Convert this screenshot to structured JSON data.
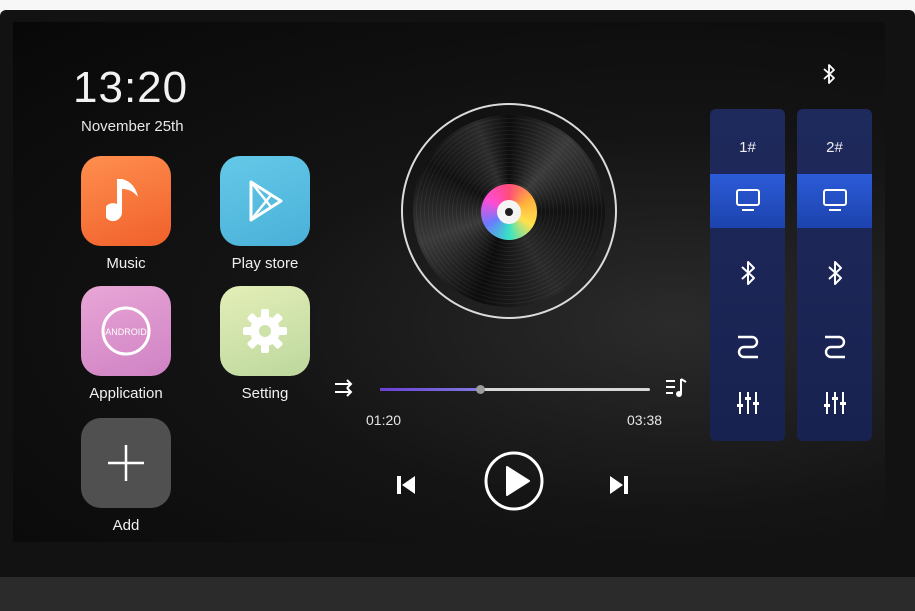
{
  "clock": {
    "time": "13:20",
    "date": "November 25th"
  },
  "apps": [
    {
      "label": "Music",
      "icon": "music-note-icon"
    },
    {
      "label": "Play store",
      "icon": "play-store-icon"
    },
    {
      "label": "Application",
      "icon": "android-icon",
      "icon_text": "ANDROID"
    },
    {
      "label": "Setting",
      "icon": "gear-icon"
    },
    {
      "label": "Add",
      "icon": "plus-icon"
    }
  ],
  "player": {
    "elapsed": "01:20",
    "duration": "03:38",
    "progress": 0.37,
    "controls": [
      "shuffle-icon",
      "previous-icon",
      "play-icon",
      "next-icon",
      "playlist-icon"
    ]
  },
  "status_bar": {
    "bluetooth_icon": "bluetooth-icon"
  },
  "speakers": [
    {
      "title": "1#",
      "selected": "screen-icon",
      "items": [
        "screen-icon",
        "bluetooth-icon",
        "cable-icon",
        "equalizer-icon"
      ]
    },
    {
      "title": "2#",
      "selected": "screen-icon",
      "items": [
        "screen-icon",
        "bluetooth-icon",
        "cable-icon",
        "equalizer-icon"
      ]
    }
  ],
  "colors": {
    "music": "#f2692f",
    "play_store": "#57bfe2",
    "application": "#db95cf",
    "setting": "#cde3a9",
    "speaker_panel": "#1c2656",
    "speaker_selected": "#2450c4",
    "progress": "#6f58dc"
  }
}
